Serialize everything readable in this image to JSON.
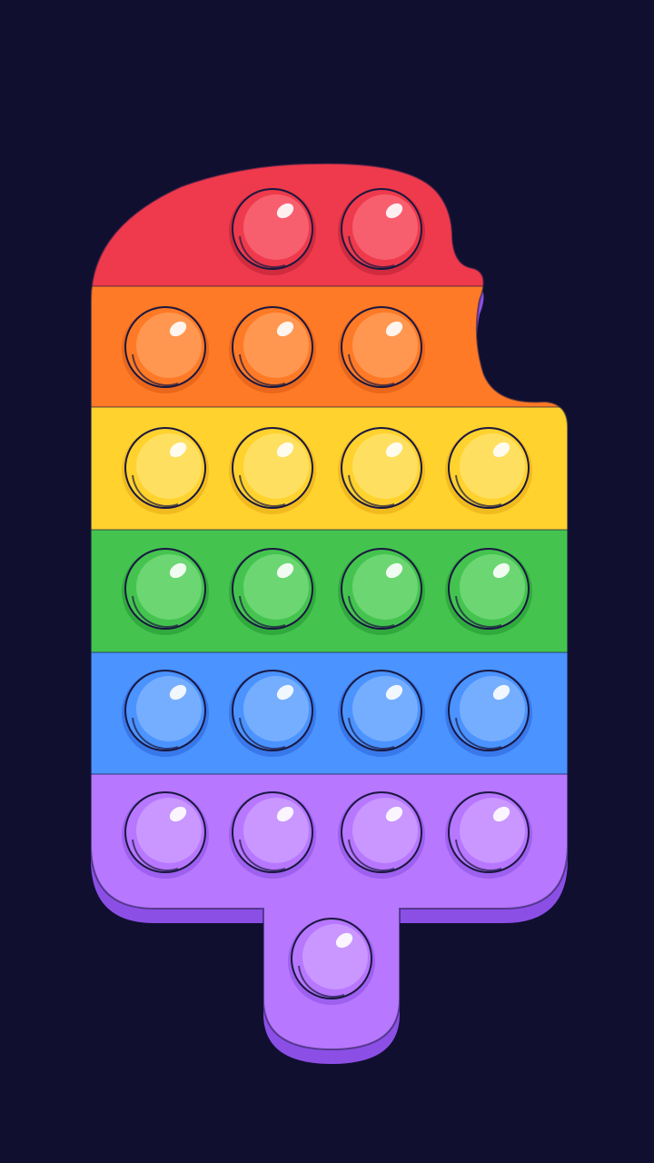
{
  "game": {
    "name": "pop-it-popsicle",
    "background": "#100f30"
  },
  "rows": [
    {
      "name": "red",
      "color": "#ee3a4c",
      "dark": "#b81f33",
      "light": "#ff7e8b",
      "bubbles": 2
    },
    {
      "name": "orange",
      "color": "#ff7a26",
      "dark": "#d85812",
      "light": "#ffae73",
      "bubbles": 3
    },
    {
      "name": "yellow",
      "color": "#ffd22e",
      "dark": "#e6a812",
      "light": "#ffe98a",
      "bubbles": 4
    },
    {
      "name": "green",
      "color": "#44c44f",
      "dark": "#23962f",
      "light": "#8ee68f",
      "bubbles": 4
    },
    {
      "name": "blue",
      "color": "#4b93ff",
      "dark": "#2a63d8",
      "light": "#9bc4ff",
      "bubbles": 4
    },
    {
      "name": "purple",
      "color": "#b777ff",
      "dark": "#8a4ee0",
      "light": "#d9b2ff",
      "bubbles": 4
    }
  ],
  "stick": {
    "color": "#b777ff",
    "dark": "#8a4ee0",
    "light": "#d9b2ff",
    "bubbles": 1
  },
  "popped_count": 0,
  "total_bubbles": 22
}
